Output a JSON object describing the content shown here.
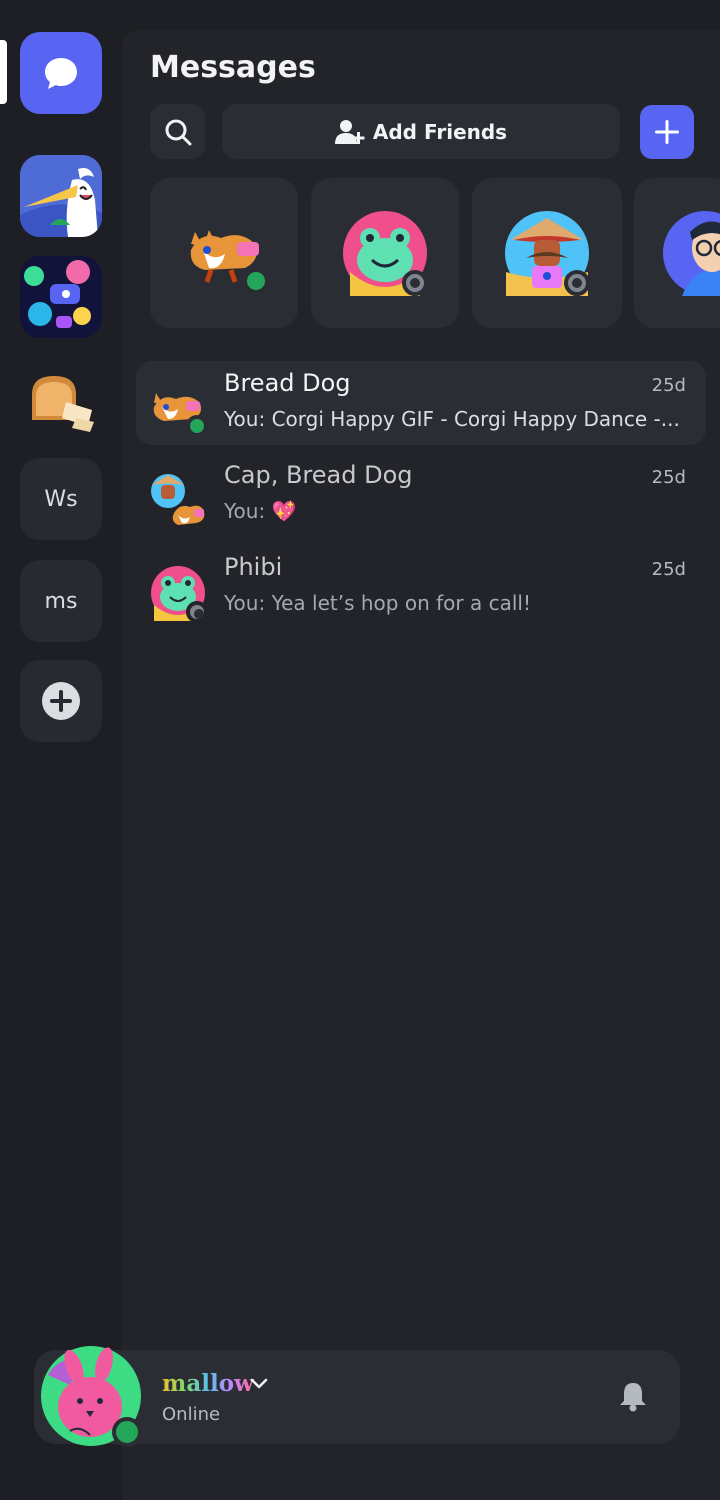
{
  "header": {
    "title": "Messages"
  },
  "toolbar": {
    "add_friends_label": "Add Friends"
  },
  "servers": [
    {
      "id": "dm-home",
      "icon": "chat-bubble-icon"
    },
    {
      "id": "server-bird",
      "icon": "bird-server-icon"
    },
    {
      "id": "server-art",
      "icon": "art-server-icon"
    },
    {
      "id": "server-bread",
      "icon": "bread-server-icon"
    },
    {
      "id": "server-ws",
      "label": "Ws"
    },
    {
      "id": "server-ms",
      "label": "ms"
    },
    {
      "id": "add-server",
      "icon": "plus-icon"
    }
  ],
  "friends_strip": [
    {
      "avatar": "corgi-avatar",
      "status": "online"
    },
    {
      "avatar": "frog-avatar",
      "status": "offline"
    },
    {
      "avatar": "cap-avatar",
      "status": "offline"
    },
    {
      "avatar": "glasses-avatar",
      "status": ""
    }
  ],
  "dms": [
    {
      "name": "Bread Dog",
      "time": "25d",
      "preview": "You: Corgi Happy GIF - Corgi Happy Dance -...",
      "status": "online"
    },
    {
      "name": "Cap, Bread Dog",
      "time": "25d",
      "preview": "You: 💖",
      "status": ""
    },
    {
      "name": "Phibi",
      "time": "25d",
      "preview": "You: Yea let’s hop on for a call!",
      "status": "offline"
    }
  ],
  "user": {
    "name": "mallow",
    "status": "Online"
  },
  "colors": {
    "accent": "#5865f2",
    "online": "#23a55a",
    "offline": "#80848e",
    "background": "#1e1f24",
    "panel": "#232429",
    "card": "#2b2d34"
  }
}
